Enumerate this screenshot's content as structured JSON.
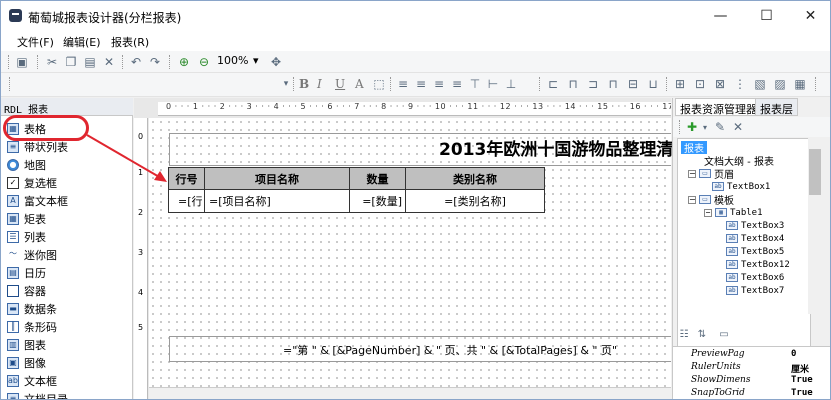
{
  "window": {
    "title": "葡萄城报表设计器(分栏报表)",
    "min": "—",
    "max": "☐",
    "close": "✕"
  },
  "menu": [
    "文件(F)",
    "编辑(E)",
    "报表(R)"
  ],
  "toolbar": {
    "zoom": "100%",
    "zoom_arrow": "▾",
    "format_glyphs": [
      "B",
      "I",
      "U",
      "A"
    ]
  },
  "left_panel": {
    "header": "RDL 报表",
    "items": [
      "表格",
      "带状列表",
      "地图",
      "复选框",
      "富文本框",
      "矩表",
      "列表",
      "迷你图",
      "日历",
      "容器",
      "数据条",
      "条形码",
      "图表",
      "图像",
      "文本框",
      "文档目录"
    ]
  },
  "ruler": {
    "top": "0 · · · 1 · · · 2 · · · 3 · · · 4 · · · 5 · · · 6 · · · 7 · · · 8 · · · 9 · · · 10 · · · 11 · · · 12 · · · 13 · · · 14 · · · 15 · · · 16 · · · 17 · · ·",
    "side": [
      "0",
      "1",
      "2",
      "3",
      "4",
      "5"
    ]
  },
  "report": {
    "title": "2013年欧洲十国游物品整理清",
    "table": {
      "headers": [
        "行号",
        "项目名称",
        "数量",
        "类别名称"
      ],
      "cells": [
        "=[行",
        "=[项目名称]",
        "=[数量]",
        "=[类别名称]"
      ]
    },
    "footer": "=\"第 \" & [&PageNumber] & \" 页、共 \" & [&TotalPages] & \" 页\""
  },
  "right_panel": {
    "tabs": [
      "报表资源管理器",
      "报表层"
    ],
    "tree": {
      "root": "报表",
      "outline": "文档大纲 - 报表",
      "page_header": "页眉",
      "textbox1": "TextBox1",
      "body": "模板",
      "table": "Table1",
      "children": [
        "TextBox3",
        "TextBox4",
        "TextBox5",
        "TextBox12",
        "TextBox6",
        "TextBox7"
      ]
    },
    "properties": [
      {
        "name": "PreviewPag",
        "value": "0"
      },
      {
        "name": "RulerUnits",
        "value": "厘米"
      },
      {
        "name": "ShowDimens",
        "value": "True"
      },
      {
        "name": "SnapToGrid",
        "value": "True"
      }
    ]
  },
  "colors": {
    "annotation": "#e0262f",
    "header_fill": "#bfbfbf",
    "selection": "#3399ff"
  }
}
